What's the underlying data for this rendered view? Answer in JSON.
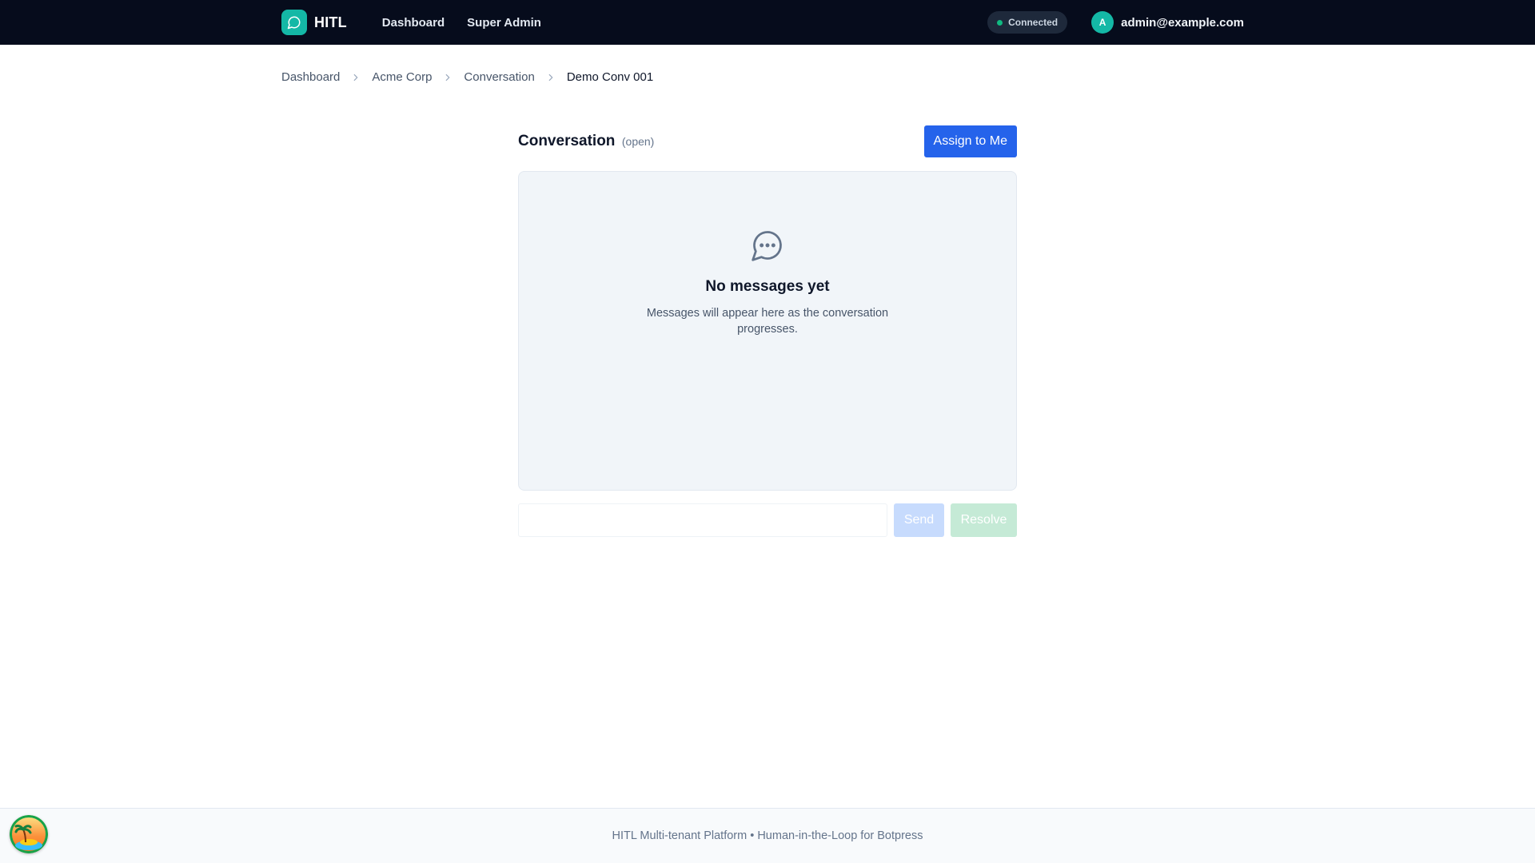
{
  "app": {
    "brand": "HITL",
    "nav": [
      "Dashboard",
      "Super Admin"
    ],
    "connection_status": "Connected",
    "user": {
      "avatar_initial": "A",
      "email": "admin@example.com"
    }
  },
  "breadcrumb": {
    "items": [
      "Dashboard",
      "Acme Corp",
      "Conversation"
    ],
    "current": "Demo Conv 001"
  },
  "conversation": {
    "title": "Conversation",
    "status": "(open)",
    "assign_label": "Assign to Me",
    "empty_state": {
      "icon": "chat-bubble-icon",
      "title": "No messages yet",
      "subtitle": "Messages will appear here as the conversation progresses."
    },
    "composer": {
      "input_value": "",
      "send_label": "Send",
      "resolve_label": "Resolve"
    }
  },
  "footer": {
    "text": "HITL Multi-tenant Platform • Human-in-the-Loop for Botpress"
  },
  "colors": {
    "topbar": "#060c1c",
    "accent": "#14b8a6",
    "primary": "#2563eb",
    "connected": "#10b981"
  }
}
